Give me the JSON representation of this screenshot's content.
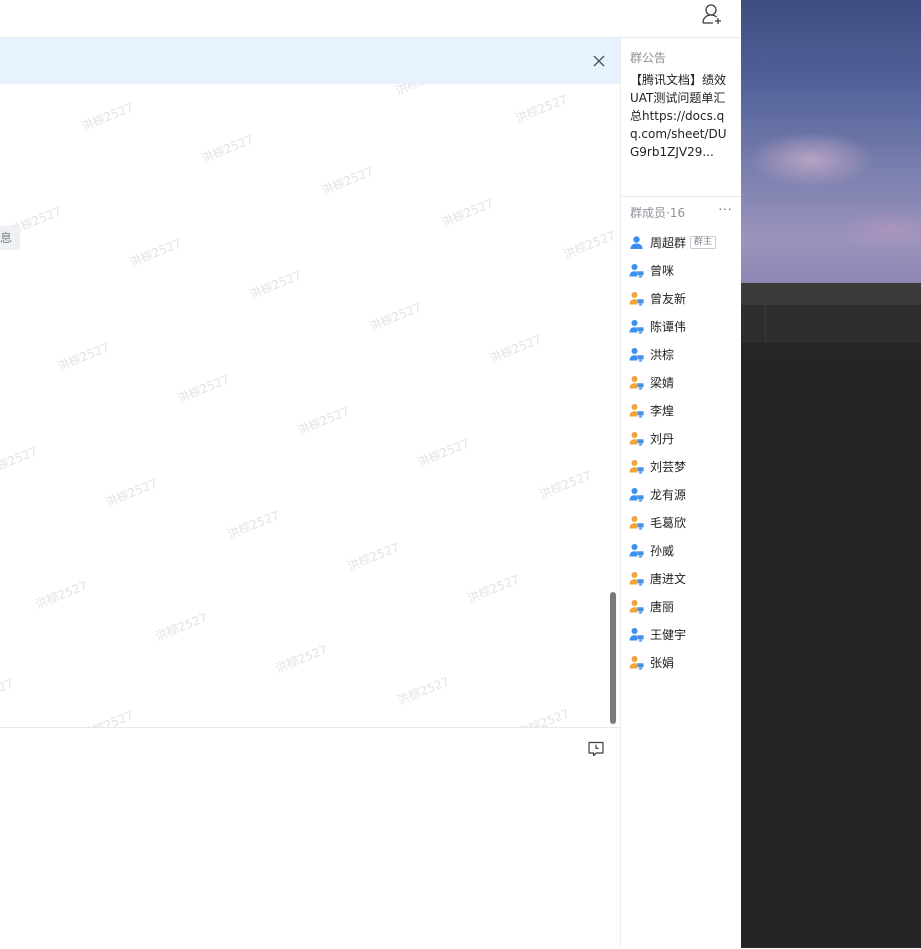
{
  "watermark_text": "洪棕2527",
  "chat": {
    "system_message_fragment": "息"
  },
  "right_panel": {
    "announcement": {
      "title": "群公告",
      "content": "【腾讯文档】绩效UAT测试问题单汇总https://docs.qq.com/sheet/DUG9rb1ZJV29..."
    },
    "members": {
      "title": "群成员·16",
      "more_label": "···",
      "owner_tag": "群主",
      "items": [
        {
          "name": "周超群",
          "role": "owner",
          "icon": "person-blue-icon"
        },
        {
          "name": "曾咪",
          "icon": "user-pc-blue-icon"
        },
        {
          "name": "曾友新",
          "icon": "user-pc-orange-icon"
        },
        {
          "name": "陈谭伟",
          "icon": "user-pc-blue-icon"
        },
        {
          "name": "洪棕",
          "icon": "user-pc-blue-icon"
        },
        {
          "name": "梁婧",
          "icon": "user-pc-orange-icon"
        },
        {
          "name": "李煌",
          "icon": "user-pc-orange-icon"
        },
        {
          "name": "刘丹",
          "icon": "user-pc-orange-icon"
        },
        {
          "name": "刘芸梦",
          "icon": "user-pc-orange-icon"
        },
        {
          "name": "龙有源",
          "icon": "user-pc-blue-icon"
        },
        {
          "name": "毛葛欣",
          "icon": "user-pc-orange-icon"
        },
        {
          "name": "孙威",
          "icon": "user-pc-blue-icon"
        },
        {
          "name": "唐进文",
          "icon": "user-pc-orange-icon"
        },
        {
          "name": "唐丽",
          "icon": "user-pc-orange-icon"
        },
        {
          "name": "王健宇",
          "icon": "user-pc-blue-icon"
        },
        {
          "name": "张娟",
          "icon": "user-pc-orange-icon"
        }
      ]
    }
  },
  "colors": {
    "notice_bar": "#e6f2fd",
    "member_blue": "#3b8ff0",
    "member_orange": "#f2a43a",
    "pc_badge": "#4a90e2"
  }
}
